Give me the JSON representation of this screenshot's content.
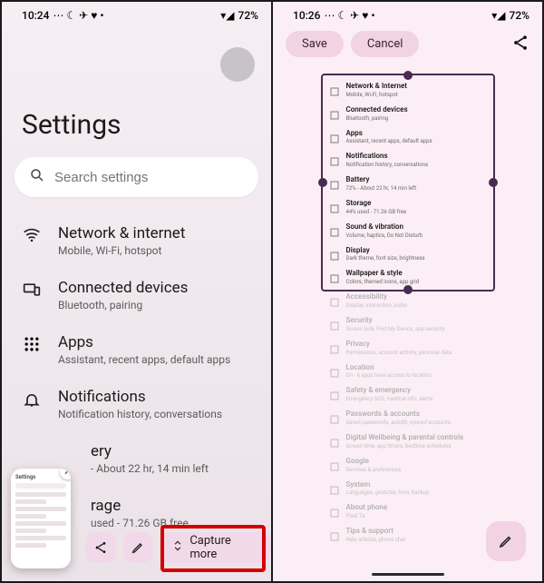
{
  "left": {
    "status": {
      "time": "10:24",
      "battery": "72%"
    },
    "title": "Settings",
    "search_placeholder": "Search settings",
    "items": [
      {
        "title": "Network & internet",
        "sub": "Mobile, Wi-Fi, hotspot"
      },
      {
        "title": "Connected devices",
        "sub": "Bluetooth, pairing"
      },
      {
        "title": "Apps",
        "sub": "Assistant, recent apps, default apps"
      },
      {
        "title": "Notifications",
        "sub": "Notification history, conversations"
      },
      {
        "title_suffix": "ery",
        "sub": "- About 22 hr, 14 min left"
      },
      {
        "title_suffix": "rage",
        "sub": "used - 71.26 GB free"
      }
    ],
    "capture_label": "Capture more"
  },
  "right": {
    "status": {
      "time": "10:26",
      "battery": "72%"
    },
    "save": "Save",
    "cancel": "Cancel",
    "inside": [
      {
        "a": "Network & Internet",
        "b": "Mobile, Wi-Fi, hotspot"
      },
      {
        "a": "Connected devices",
        "b": "Bluetooth, pairing"
      },
      {
        "a": "Apps",
        "b": "Assistant, recent apps, default apps"
      },
      {
        "a": "Notifications",
        "b": "Notification history, conversations"
      },
      {
        "a": "Battery",
        "b": "72% - About 22 hr, 14 min left"
      },
      {
        "a": "Storage",
        "b": "44% used - 71.26 GB free"
      },
      {
        "a": "Sound & vibration",
        "b": "Volume, haptics, Do Not Disturb"
      },
      {
        "a": "Display",
        "b": "Dark theme, font size, brightness"
      },
      {
        "a": "Wallpaper & style",
        "b": "Colors, themed icons, app grid"
      }
    ],
    "outside": [
      {
        "a": "Accessibility",
        "b": "Display, interaction, audio"
      },
      {
        "a": "Security",
        "b": "Screen lock, Find My Device, app security"
      },
      {
        "a": "Privacy",
        "b": "Permissions, account activity, personal data"
      },
      {
        "a": "Location",
        "b": "On - 6 apps have access to location"
      },
      {
        "a": "Safety & emergency",
        "b": "Emergency SOS, medical info, alerts"
      },
      {
        "a": "Passwords & accounts",
        "b": "Saved passwords, autofill, synced accounts"
      },
      {
        "a": "Digital Wellbeing & parental controls",
        "b": "Screen time, app timers, bedtime schedules"
      },
      {
        "a": "Google",
        "b": "Services & preferences"
      },
      {
        "a": "System",
        "b": "Languages, gestures, time, backup"
      },
      {
        "a": "About phone",
        "b": "Pixel 7a"
      },
      {
        "a": "Tips & support",
        "b": "Help articles, phone chat"
      }
    ]
  }
}
